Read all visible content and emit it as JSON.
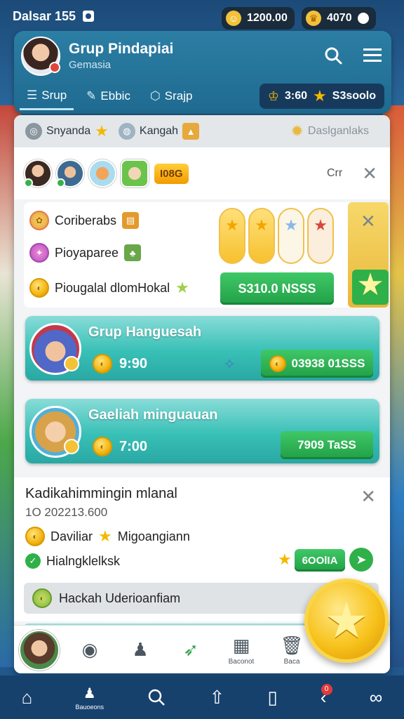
{
  "status": {
    "time": "Dalsar 155"
  },
  "top_pills": [
    {
      "icon": "face-coin-icon",
      "value": "1200.00"
    },
    {
      "icon": "crown-icon",
      "value": "4070"
    }
  ],
  "header": {
    "title": "Grup Pindapiai",
    "subtitle": "Gemasia"
  },
  "tabs": [
    {
      "label": "Srup",
      "icon": "layers-icon"
    },
    {
      "label": "Ebbic",
      "icon": "brush-icon"
    },
    {
      "label": "Srajp",
      "icon": "cube-icon"
    }
  ],
  "tab_coins": {
    "value": "3:60",
    "label": "S3soolo"
  },
  "filters": [
    {
      "label": "Snyanda"
    },
    {
      "label": "Kangah"
    }
  ],
  "filter_right": "Daslganlaks",
  "avatars_badge": "I08G",
  "avatars_label": "Crr",
  "list_items": [
    {
      "label": "Coriberabs"
    },
    {
      "label": "Pioyaparee"
    },
    {
      "label": "Piougalal dlomHokal"
    }
  ],
  "list_button": "S310.0 NSSS",
  "group_cards": [
    {
      "title": "Grup Hanguesah",
      "value": "9:90",
      "button": "03938 01SSS"
    },
    {
      "title": "Gaeliah minguauan",
      "value": "7:00",
      "button": "7909 TaSS"
    }
  ],
  "quest": {
    "title": "Kadikahimmingin mlanal",
    "date": "1O 202213.600",
    "line1": "Daviliar",
    "line1b": "Migoangiann",
    "line2": "Hialngklelksk",
    "button": "6OOlIA",
    "bar": "Hackah Uderioanfiam"
  },
  "bottom_nav": [
    {
      "icon": "eye-icon",
      "label": ""
    },
    {
      "icon": "pawn-icon",
      "label": ""
    },
    {
      "icon": "bird-icon",
      "label": ""
    },
    {
      "icon": "grid-icon",
      "label": "Baconot"
    },
    {
      "icon": "trash-icon",
      "label": "Baca"
    }
  ],
  "system_nav": [
    {
      "icon": "home-icon",
      "label": ""
    },
    {
      "icon": "person-icon",
      "label": "Bauoeons"
    },
    {
      "icon": "search-icon",
      "label": ""
    },
    {
      "icon": "house-up-icon",
      "label": ""
    },
    {
      "icon": "book-icon",
      "label": ""
    },
    {
      "icon": "back-icon",
      "label": "",
      "badge": "0"
    },
    {
      "icon": "grid-icon",
      "label": ""
    }
  ]
}
